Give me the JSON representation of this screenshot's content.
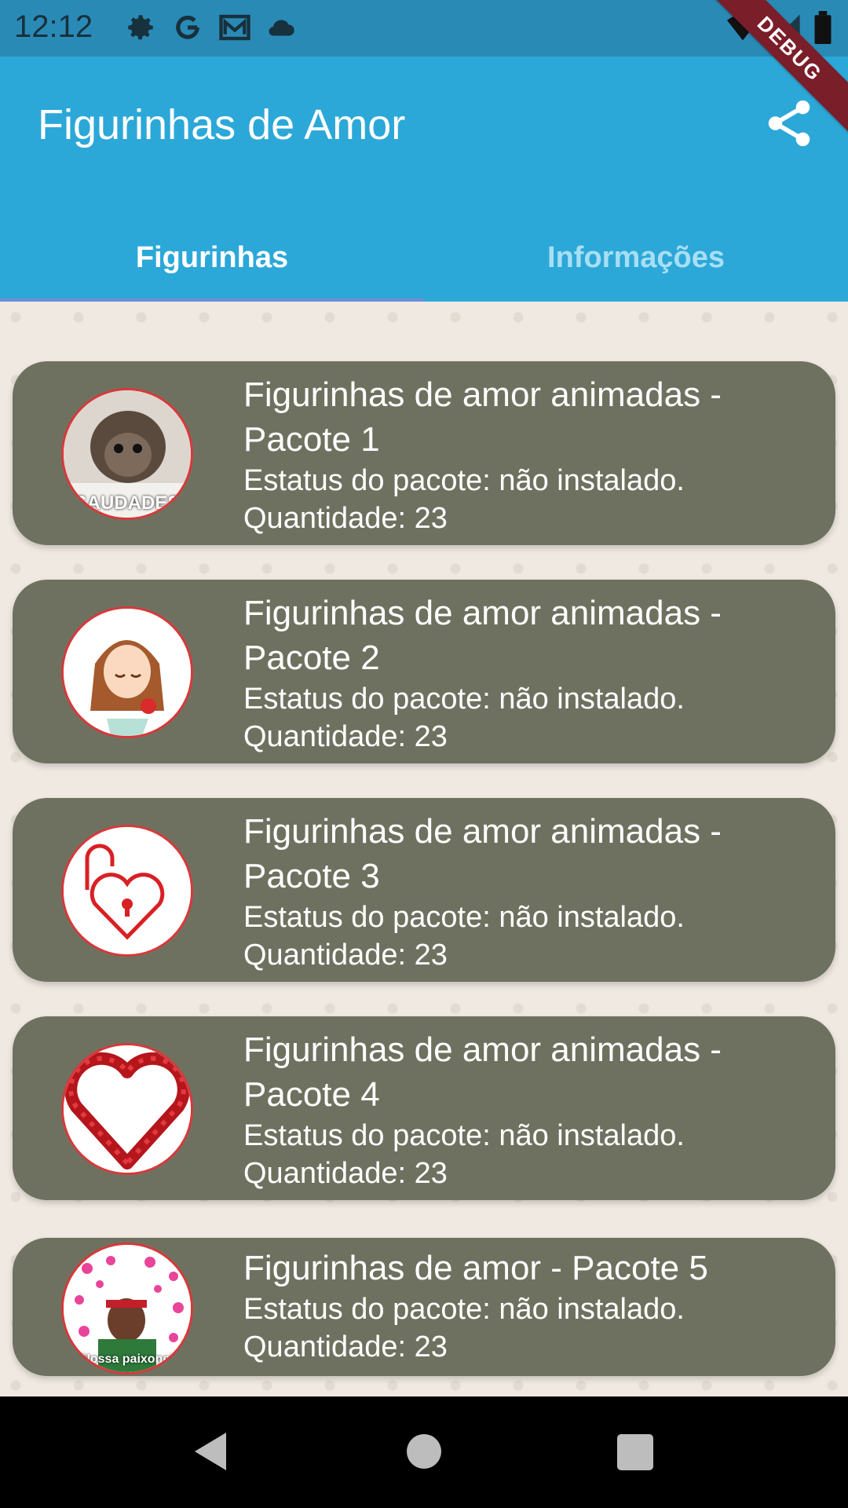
{
  "status_bar": {
    "time": "12:12"
  },
  "debug_ribbon": "DEBUG",
  "app_bar": {
    "title": "Figurinhas de Amor"
  },
  "tabs": [
    {
      "label": "Figurinhas",
      "active": true
    },
    {
      "label": "Informações",
      "active": false
    }
  ],
  "packs": [
    {
      "title": "Figurinhas de amor animadas - Pacote 1",
      "status": "Estatus do pacote: não instalado.",
      "quantity": "Quantidade: 23",
      "thumb_text": "SAUDADES"
    },
    {
      "title": "Figurinhas de amor animadas - Pacote 2",
      "status": "Estatus do pacote: não instalado.",
      "quantity": "Quantidade: 23"
    },
    {
      "title": "Figurinhas de amor animadas - Pacote 3",
      "status": "Estatus do pacote: não instalado.",
      "quantity": "Quantidade: 23"
    },
    {
      "title": "Figurinhas de amor animadas - Pacote 4",
      "status": "Estatus do pacote: não instalado.",
      "quantity": "Quantidade: 23"
    },
    {
      "title": "Figurinhas de amor - Pacote 5",
      "status": "Estatus do pacote: não instalado.",
      "quantity": "Quantidade: 23",
      "thumb_text": "Nossa paixonei"
    }
  ],
  "colors": {
    "app_bar": "#2ca8d8",
    "status_bar": "#2a8ab6",
    "card": "#6f7160",
    "accent_red": "#d8383a"
  }
}
